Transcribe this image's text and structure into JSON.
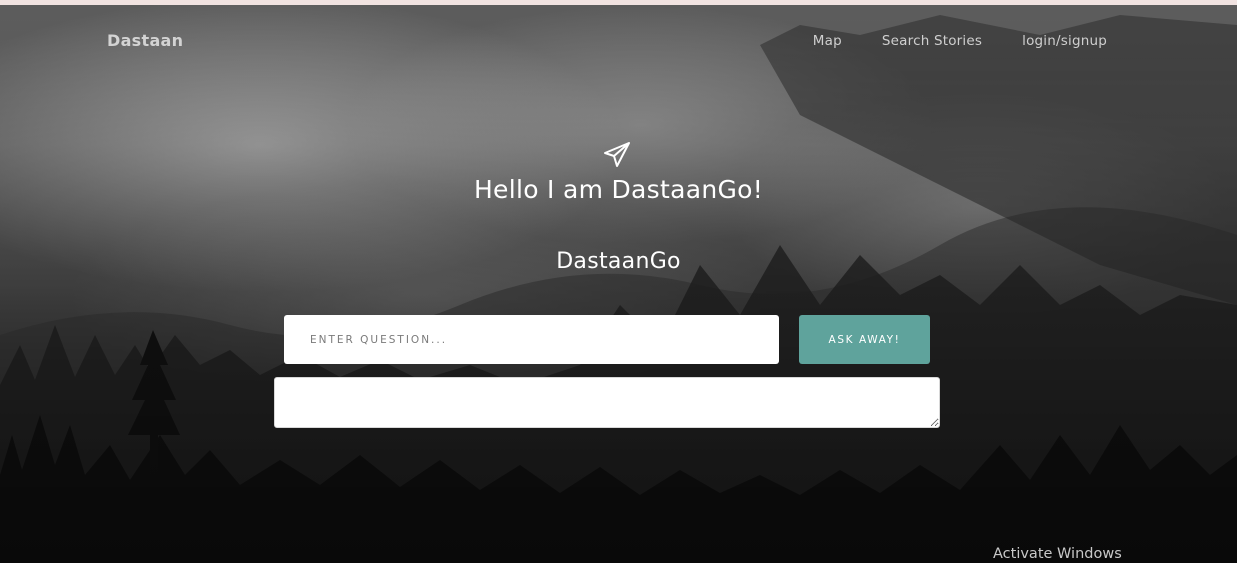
{
  "nav": {
    "brand": "Dastaan",
    "links": [
      "Map",
      "Search Stories",
      "login/signup"
    ]
  },
  "hero": {
    "icon": "paper-plane-icon",
    "title": "Hello I am DastaanGo!",
    "subtitle": "DastaanGo"
  },
  "form": {
    "question_placeholder": "ENTER QUESTION...",
    "question_value": "",
    "ask_button_label": "ASK AWAY!",
    "answer_value": ""
  },
  "colors": {
    "accent": "#5fa39c",
    "top_strip": "#f1e3e1"
  },
  "watermark": {
    "text": "Activate Windows"
  }
}
